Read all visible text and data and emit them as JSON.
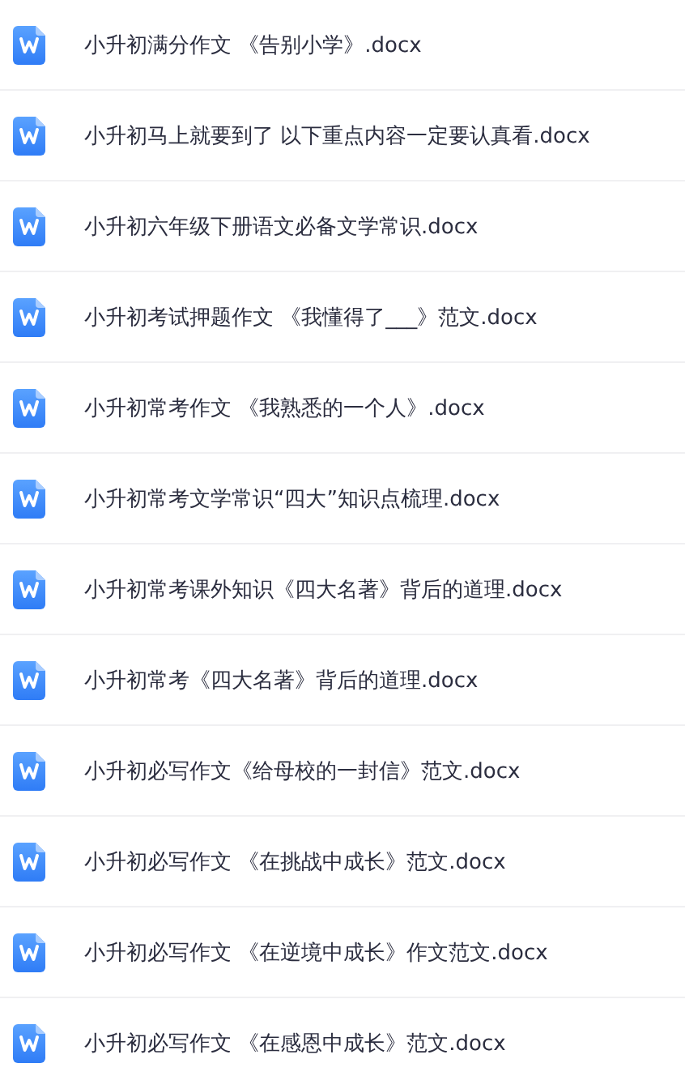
{
  "files": [
    {
      "name": "小升初满分作文 《告别小学》.docx"
    },
    {
      "name": "小升初马上就要到了 以下重点内容一定要认真看.docx"
    },
    {
      "name": "小升初六年级下册语文必备文学常识.docx"
    },
    {
      "name": "小升初考试押题作文 《我懂得了___》范文.docx"
    },
    {
      "name": "小升初常考作文 《我熟悉的一个人》.docx"
    },
    {
      "name": "小升初常考文学常识“四大”知识点梳理.docx"
    },
    {
      "name": "小升初常考课外知识《四大名著》背后的道理.docx"
    },
    {
      "name": "小升初常考《四大名著》背后的道理.docx"
    },
    {
      "name": "小升初必写作文《给母校的一封信》范文.docx"
    },
    {
      "name": "小升初必写作文 《在挑战中成长》范文.docx"
    },
    {
      "name": "小升初必写作文 《在逆境中成长》作文范文.docx"
    },
    {
      "name": "小升初必写作文 《在感恩中成长》范文.docx"
    }
  ]
}
